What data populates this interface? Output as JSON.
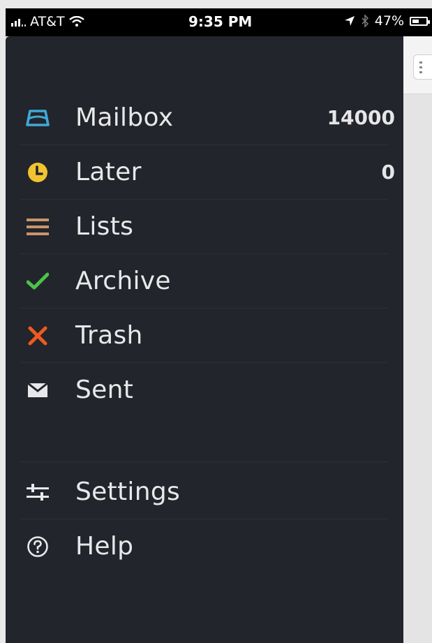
{
  "status_bar": {
    "carrier": "AT&T",
    "time": "9:35 PM",
    "battery": "47%"
  },
  "menu": {
    "items": [
      {
        "label": "Mailbox",
        "count": "14000",
        "icon": "mailbox-tray-icon",
        "color": "#3fa9d8"
      },
      {
        "label": "Later",
        "count": "0",
        "icon": "clock-icon",
        "color": "#f2c230"
      },
      {
        "label": "Lists",
        "icon": "list-icon",
        "color": "#c8966a"
      },
      {
        "label": "Archive",
        "icon": "checkmark-icon",
        "color": "#4cc24a"
      },
      {
        "label": "Trash",
        "icon": "x-icon",
        "color": "#ef5a1e"
      },
      {
        "label": "Sent",
        "icon": "envelope-icon",
        "color": "#e8e8ea"
      }
    ],
    "secondary_items": [
      {
        "label": "Settings",
        "icon": "sliders-icon"
      },
      {
        "label": "Help",
        "icon": "help-circle-icon"
      }
    ]
  }
}
